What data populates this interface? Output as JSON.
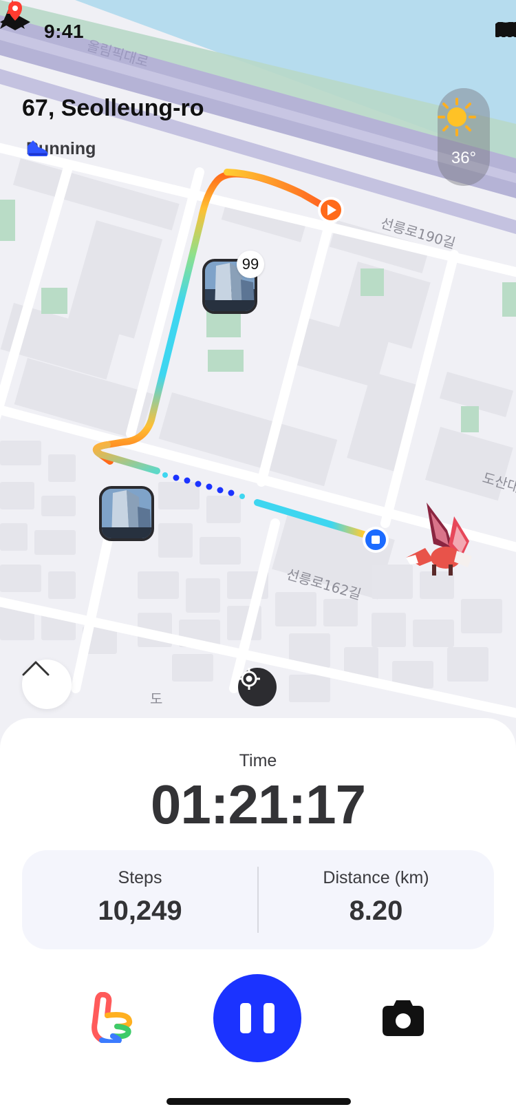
{
  "status_bar": {
    "time": "9:41",
    "icons": [
      "cellular-signal-icon",
      "wifi-icon",
      "battery-icon"
    ]
  },
  "map": {
    "location_title": "67, Seolleung-ro",
    "activity": {
      "icon": "running-shoe-icon",
      "label": "Running"
    },
    "weather": {
      "icon": "sun-icon",
      "temperature": "36°"
    },
    "street_labels": [
      "올림픽대로",
      "선릉로190길",
      "선릉로162길",
      "도산대",
      "도"
    ],
    "photo_pin_badge": "99",
    "route_colors": {
      "start": "#ff6a1a",
      "mid": "#ffcc33",
      "cool": "#3ed6f0",
      "dotted": "#1b33ff",
      "end_marker": "#1b6bff"
    }
  },
  "panel": {
    "time_label": "Time",
    "time_value": "01:21:17",
    "stats": [
      {
        "label": "Steps",
        "value": "10,249"
      },
      {
        "label": "Distance (km)",
        "value": "8.20"
      }
    ]
  },
  "colors": {
    "accent": "#1b33ff",
    "text_dark": "#333336"
  }
}
